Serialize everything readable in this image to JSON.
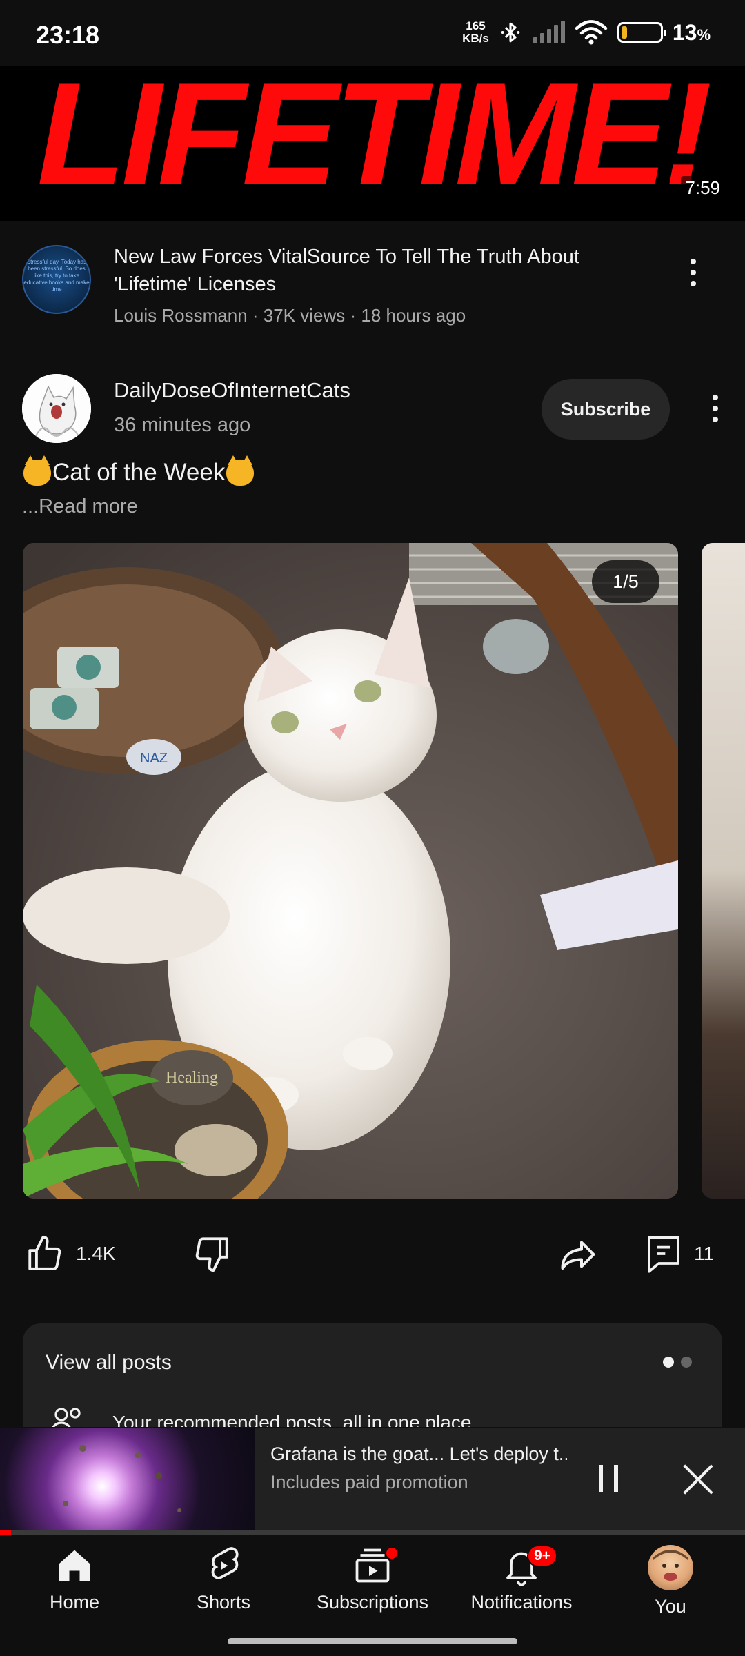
{
  "status_bar": {
    "time": "23:18",
    "net_speed_value": "165",
    "net_speed_unit": "KB/s",
    "battery_percent": "13",
    "battery_pct_symbol": "%",
    "battery_level": 0.13,
    "battery_color": "#f1b41f"
  },
  "video": {
    "thumbnail_text": "LIFETIME!",
    "duration": "7:59",
    "title": "New Law Forces VitalSource To Tell The Truth About 'Lifetime' Licenses",
    "subtitle": "Louis Rossmann · 37K views · 18 hours ago",
    "avatar_text": "Stressful day. Today has been stressful. So does like this, try to take educative books and make time"
  },
  "post": {
    "channel": "DailyDoseOfInternetCats",
    "time": "36 minutes ago",
    "subscribe_label": "Subscribe",
    "text": "Cat of the Week",
    "read_more": "...Read more",
    "image_counter": "1/5",
    "image_stone_text": "Healing",
    "likes": "1.4K",
    "comments": "11"
  },
  "view_all_card": {
    "title": "View all posts",
    "subtitle": "Your recommended posts, all in one place"
  },
  "mini_player": {
    "title": "Grafana is the goat... Let's deploy t...",
    "subtitle": "Includes paid promotion",
    "progress": 0.015
  },
  "bottom_nav": {
    "home": "Home",
    "shorts": "Shorts",
    "subscriptions": "Subscriptions",
    "notifications": "Notifications",
    "notifications_badge": "9+",
    "you": "You"
  },
  "colors": {
    "background": "#0f0f0f",
    "accent_red": "#ff0000",
    "thumbnail_red": "#ff0a0a",
    "surface": "#212121"
  }
}
